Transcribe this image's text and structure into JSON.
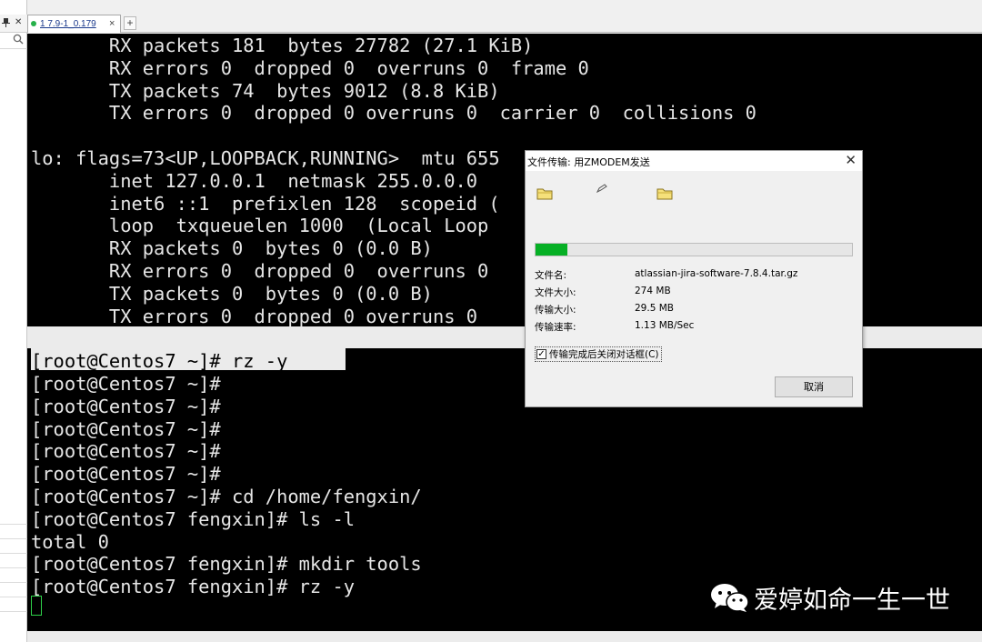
{
  "sidebar": {
    "pin_icon": "pin-icon",
    "close_glyph": "✕",
    "search_icon": "search-icon"
  },
  "tabs": [
    {
      "label": "1 7.9-1_0.179",
      "status_color": "#26b14a",
      "close_glyph": "×"
    }
  ],
  "add_tab_glyph": "+",
  "terminal": {
    "lines": [
      "       RX packets 181  bytes 27782 (27.1 KiB)",
      "       RX errors 0  dropped 0  overruns 0  frame 0",
      "       TX packets 74  bytes 9012 (8.8 KiB)",
      "       TX errors 0  dropped 0 overruns 0  carrier 0  collisions 0",
      "",
      "lo: flags=73<UP,LOOPBACK,RUNNING>  mtu 655",
      "       inet 127.0.0.1  netmask 255.0.0.0",
      "       inet6 ::1  prefixlen 128  scopeid (",
      "       loop  txqueuelen 1000  (Local Loop",
      "       RX packets 0  bytes 0 (0.0 B)",
      "       RX errors 0  dropped 0  overruns 0",
      "       TX packets 0  bytes 0 (0.0 B)",
      "       TX errors 0  dropped 0 overruns 0",
      "",
      "[root@Centos7 ~]# rz -y",
      "[root@Centos7 ~]#",
      "[root@Centos7 ~]#",
      "[root@Centos7 ~]#",
      "[root@Centos7 ~]#",
      "[root@Centos7 ~]#",
      "[root@Centos7 ~]# cd /home/fengxin/",
      "[root@Centos7 fengxin]# ls -l",
      "total 0",
      "[root@Centos7 fengxin]# mkdir tools",
      "[root@Centos7 fengxin]# rz -y"
    ],
    "cursor_color": "#2fd24a"
  },
  "dialog": {
    "title": "文件传输: 用ZMODEM发送",
    "close_glyph": "✕",
    "progress_fraction": 0.1,
    "progress_color": "#06b025",
    "info": [
      {
        "label": "文件名:",
        "value": "atlassian-jira-software-7.8.4.tar.gz"
      },
      {
        "label": "文件大小:",
        "value": "274 MB"
      },
      {
        "label": "传输大小:",
        "value": "29.5 MB"
      },
      {
        "label": "传输速率:",
        "value": "1.13 MB/Sec"
      }
    ],
    "checkbox_label": "传输完成后关闭对话框(C)",
    "checkbox_checked": true,
    "checkbox_mark": "✓",
    "cancel_label": "取消"
  },
  "watermark": {
    "text": "爱婷如命一生一世",
    "icon": "wechat-icon"
  }
}
